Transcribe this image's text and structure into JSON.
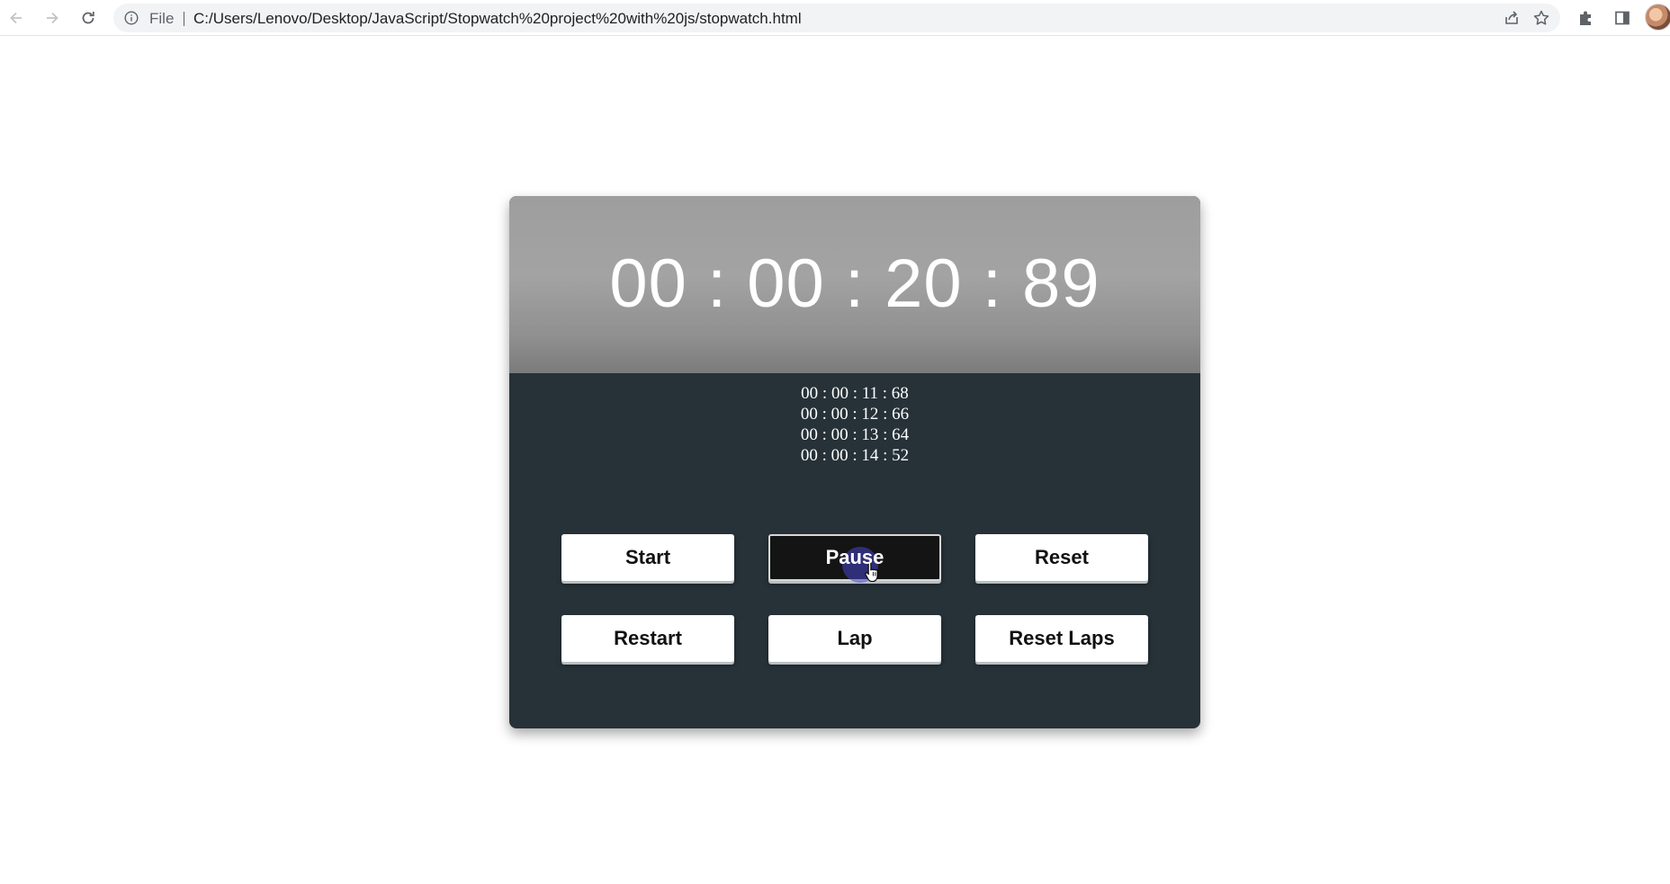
{
  "browser": {
    "scheme_label": "File",
    "url": "C:/Users/Lenovo/Desktop/JavaScript/Stopwatch%20project%20with%20js/stopwatch.html"
  },
  "stopwatch": {
    "time": "00 : 00 : 20 : 89",
    "laps": [
      "00 : 00 : 11 : 68",
      "00 : 00 : 12 : 66",
      "00 : 00 : 13 : 64",
      "00 : 00 : 14 : 52"
    ],
    "buttons": {
      "start": "Start",
      "pause": "Pause",
      "reset": "Reset",
      "restart": "Restart",
      "lap": "Lap",
      "reset_laps": "Reset Laps"
    }
  }
}
